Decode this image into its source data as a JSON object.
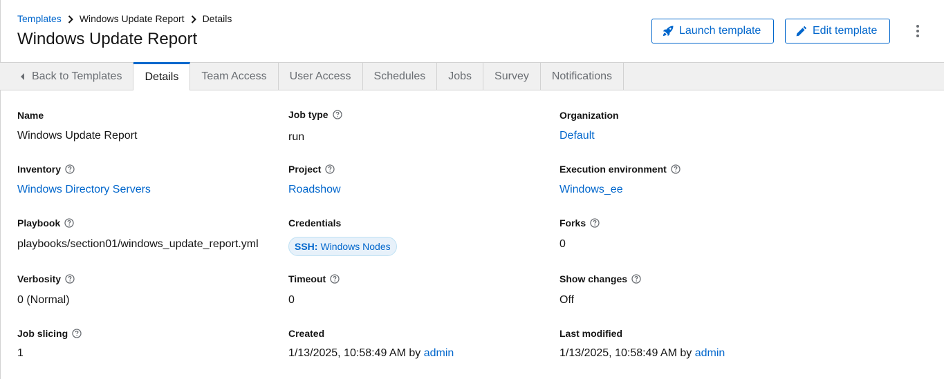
{
  "breadcrumb": {
    "item1": "Templates",
    "item2": "Windows Update Report",
    "item3": "Details"
  },
  "page_title": "Windows Update Report",
  "actions": {
    "launch": "Launch template",
    "edit": "Edit template"
  },
  "tabs": {
    "back": "Back to Templates",
    "details": "Details",
    "team_access": "Team Access",
    "user_access": "User Access",
    "schedules": "Schedules",
    "jobs": "Jobs",
    "survey": "Survey",
    "notifications": "Notifications"
  },
  "details": {
    "name": {
      "label": "Name",
      "value": "Windows Update Report"
    },
    "job_type": {
      "label": "Job type",
      "value": "run"
    },
    "organization": {
      "label": "Organization",
      "value": "Default"
    },
    "inventory": {
      "label": "Inventory",
      "value": "Windows Directory Servers"
    },
    "project": {
      "label": "Project",
      "value": "Roadshow"
    },
    "execution_environment": {
      "label": "Execution environment",
      "value": "Windows_ee"
    },
    "playbook": {
      "label": "Playbook",
      "value": "playbooks/section01/windows_update_report.yml"
    },
    "credentials": {
      "label": "Credentials",
      "chip_type": "SSH:",
      "chip_name": "Windows Nodes"
    },
    "forks": {
      "label": "Forks",
      "value": "0"
    },
    "verbosity": {
      "label": "Verbosity",
      "value": "0 (Normal)"
    },
    "timeout": {
      "label": "Timeout",
      "value": "0"
    },
    "show_changes": {
      "label": "Show changes",
      "value": "Off"
    },
    "job_slicing": {
      "label": "Job slicing",
      "value": "1"
    },
    "created": {
      "label": "Created",
      "value": "1/13/2025, 10:58:49 AM by",
      "user": "admin"
    },
    "last_modified": {
      "label": "Last modified",
      "value": "1/13/2025, 10:58:49 AM by",
      "user": "admin"
    }
  },
  "colors": {
    "link": "#0066cc",
    "tab_active": "#0066cc",
    "tab_bar": "#f0f0f0"
  },
  "icons": {
    "launch": "rocket-icon",
    "edit": "pencil-icon",
    "help": "question-circle-icon",
    "kebab": "kebab-icon",
    "back": "caret-left-icon",
    "breadcrumb_sep": "angle-right-icon"
  }
}
